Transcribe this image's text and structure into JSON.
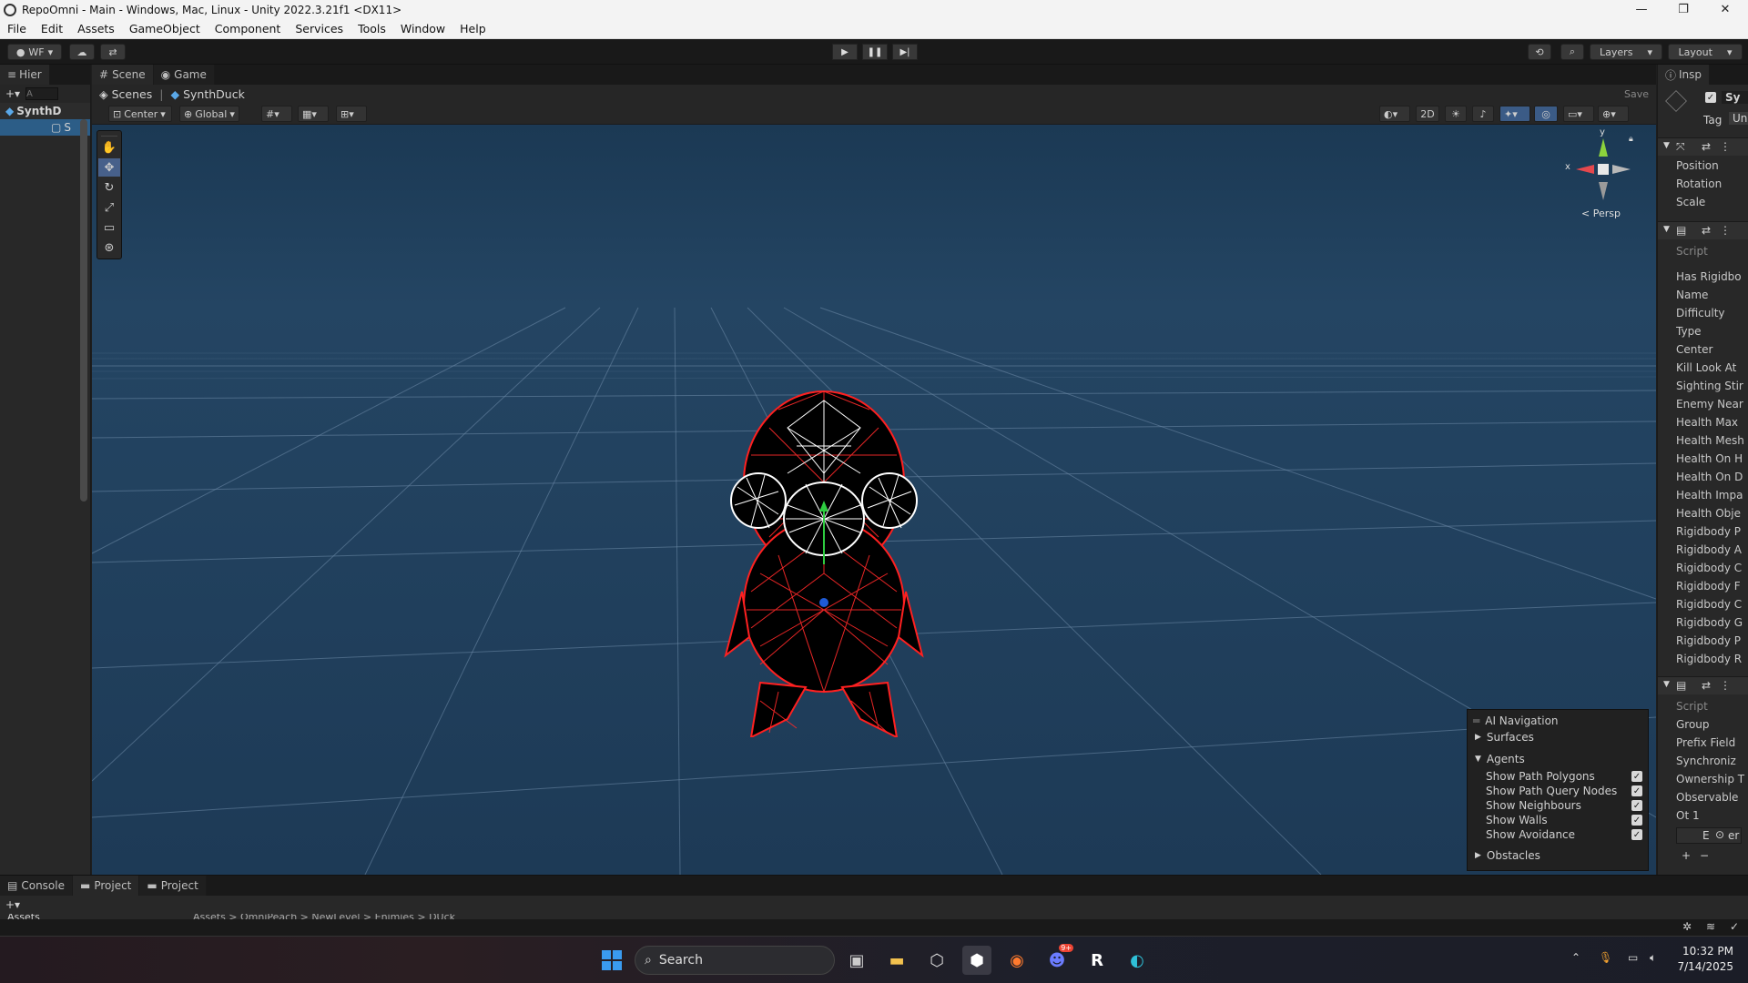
{
  "window": {
    "title": "RepoOmni - Main - Windows, Mac, Linux - Unity 2022.3.21f1 <DX11>",
    "controls": [
      "—",
      "❐",
      "✕"
    ]
  },
  "menu": [
    "File",
    "Edit",
    "Assets",
    "GameObject",
    "Component",
    "Services",
    "Tools",
    "Window",
    "Help"
  ],
  "toolbar": {
    "account": "WF",
    "layers": "Layers",
    "layout": "Layout"
  },
  "hierarchy": {
    "tab": "Hier",
    "search_placeholder": "A",
    "root": "SynthD",
    "item1": "S"
  },
  "scene": {
    "tabs": [
      "Scene",
      "Game"
    ],
    "breadcrumb": [
      "Scenes",
      "SynthDuck"
    ],
    "save_label": "Save",
    "pivot": "Center",
    "space": "Global",
    "view2d": "2D",
    "persp_label": "Persp",
    "gizmo_x": "x",
    "gizmo_y": "y"
  },
  "ai_navigation": {
    "title": "AI Navigation",
    "surfaces": "Surfaces",
    "agents": "Agents",
    "options": [
      {
        "label": "Show Path Polygons",
        "checked": true
      },
      {
        "label": "Show Path Query Nodes",
        "checked": true
      },
      {
        "label": "Show Neighbours",
        "checked": true
      },
      {
        "label": "Show Walls",
        "checked": true
      },
      {
        "label": "Show Avoidance",
        "checked": true
      }
    ],
    "obstacles": "Obstacles"
  },
  "inspector": {
    "tab": "Insp",
    "name": "Sy",
    "tag_label": "Tag",
    "tag_value": "Un",
    "transform": [
      "Position",
      "Rotation",
      "Scale"
    ],
    "script_label": "Script",
    "component1_fields": [
      "Has Rigidbo",
      "Name",
      "Difficulty",
      "Type",
      "Center",
      "Kill Look At",
      "Sighting Stir",
      "Enemy Near",
      "Health Max",
      "Health Mesh",
      "Health On H",
      "Health On D",
      "Health Impa",
      "Health Obje",
      "Rigidbody P",
      "Rigidbody A",
      "Rigidbody C",
      "Rigidbody F",
      "Rigidbody C",
      "Rigidbody G",
      "Rigidbody P",
      "Rigidbody R"
    ],
    "component2_fields": [
      "Group",
      "Prefix Field",
      "Synchroniz",
      "Ownership T",
      "Observable"
    ],
    "list_item": "Ot 1",
    "list_elem": "E",
    "list_suffix": "er"
  },
  "bottom": {
    "tabs": [
      "Console",
      "Project",
      "Project"
    ],
    "assets_label": "Assets",
    "path": "Assets > OmniPeach > NewLevel > Enimies > DUck"
  },
  "taskbar": {
    "search_label": "Search",
    "time": "10:32 PM",
    "date": "7/14/2025",
    "discord_badge": "9+"
  }
}
